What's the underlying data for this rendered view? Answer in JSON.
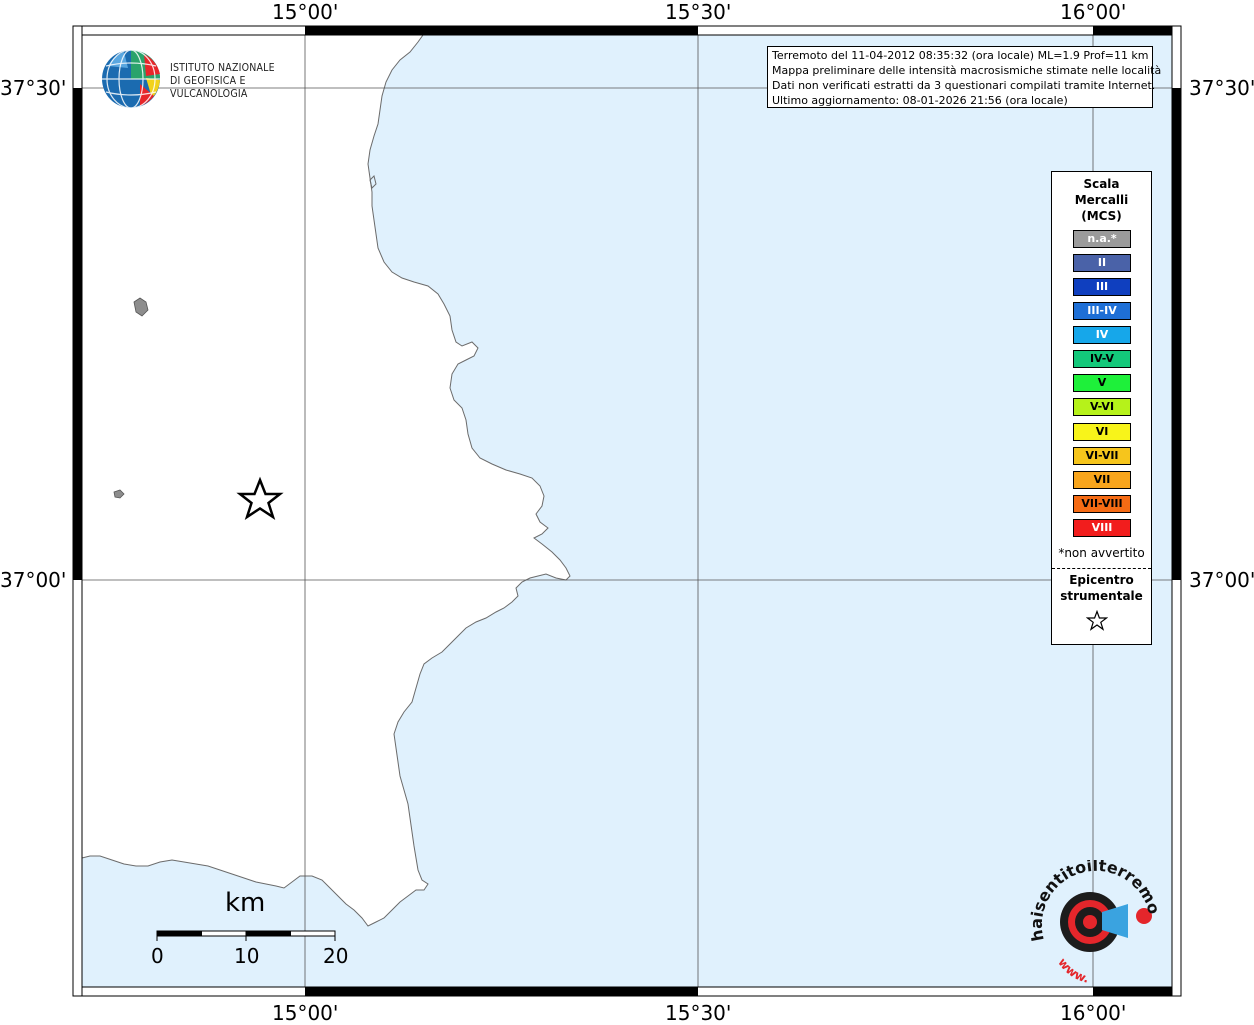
{
  "map": {
    "lon_labels": [
      "15°00'",
      "15°30'",
      "16°00'"
    ],
    "lat_labels": [
      "37°30'",
      "37°00'"
    ],
    "sea_color": "#e0f1fd",
    "land_color": "#ffffff"
  },
  "logo": {
    "line1": "ISTITUTO NAZIONALE",
    "line2": "DI GEOFISICA E VULCANOLOGIA"
  },
  "info": {
    "line1": "Terremoto del 11-04-2012 08:35:32 (ora locale) ML=1.9 Prof=11 km",
    "line2": "Mappa preliminare delle intensità macrosismiche stimate nelle località",
    "line3": "Dati non verificati estratti da 3 questionari compilati tramite Internet.",
    "line4": "Ultimo aggiornamento: 08-01-2026 21:56 (ora locale)"
  },
  "legend": {
    "title1": "Scala",
    "title2": "Mercalli",
    "title3": "(MCS)",
    "classes": [
      {
        "label": "n.a.*",
        "color": "#9b9b9b",
        "text": "#ffffff"
      },
      {
        "label": "II",
        "color": "#4a62a8",
        "text": "#ffffff"
      },
      {
        "label": "III",
        "color": "#0f3fbf",
        "text": "#ffffff"
      },
      {
        "label": "III-IV",
        "color": "#1e6fd6",
        "text": "#ffffff"
      },
      {
        "label": "IV",
        "color": "#16a7ea",
        "text": "#ffffff"
      },
      {
        "label": "IV-V",
        "color": "#13c87a",
        "text": "#000000"
      },
      {
        "label": "V",
        "color": "#1ef03a",
        "text": "#000000"
      },
      {
        "label": "V-VI",
        "color": "#b6f21a",
        "text": "#000000"
      },
      {
        "label": "VI",
        "color": "#f8f41a",
        "text": "#000000"
      },
      {
        "label": "VI-VII",
        "color": "#f6c51c",
        "text": "#000000"
      },
      {
        "label": "VII",
        "color": "#f8a51c",
        "text": "#000000"
      },
      {
        "label": "VII-VIII",
        "color": "#f56b14",
        "text": "#000000"
      },
      {
        "label": "VIII",
        "color": "#f21d1d",
        "text": "#ffffff"
      }
    ],
    "note": "*non avvertito",
    "epicentre1": "Epicentro",
    "epicentre2": "strumentale"
  },
  "scale_bar": {
    "unit": "km",
    "ticks": [
      "0",
      "10",
      "20"
    ]
  },
  "watermark": {
    "text": "haisentitoilterremoto.it",
    "url": "www."
  }
}
